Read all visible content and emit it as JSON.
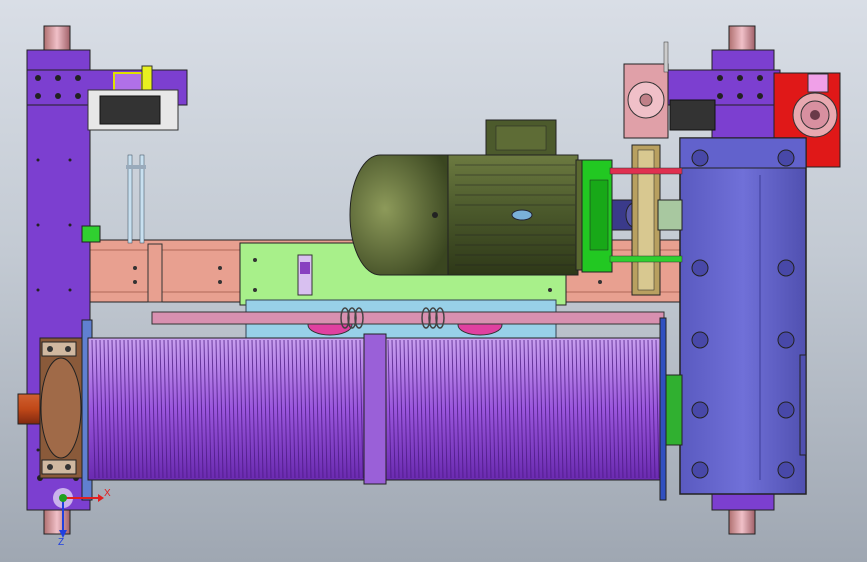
{
  "viewport": {
    "background_top": "#d9dee6",
    "background_bottom": "#9fa7b2"
  },
  "triad": {
    "x_label": "X",
    "z_label": "Z",
    "x_color": "#e02020",
    "y_color": "#20a020",
    "z_color": "#2040e0"
  },
  "colors": {
    "frame_purple": "#7c3fd0",
    "drum_purple": "#a060e0",
    "gearbox_blue": "#6a6ad0",
    "motor_green": "#4c5a2c",
    "mount_plate_green": "#a8f08a",
    "brake_red": "#e01818",
    "rail_salmon": "#e8a090",
    "bearing_brown": "#8a5a3a",
    "coupling_green": "#22c822",
    "wheel_pink": "#e0a0a8"
  },
  "parts": [
    {
      "name": "left-frame",
      "color": "frame_purple"
    },
    {
      "name": "wire-rope-drum",
      "color": "drum_purple"
    },
    {
      "name": "reducer-gearbox",
      "color": "gearbox_blue"
    },
    {
      "name": "hoist-motor",
      "color": "motor_green"
    },
    {
      "name": "motor-mount-plate",
      "color": "mount_plate_green"
    },
    {
      "name": "brake-unit",
      "color": "brake_red"
    },
    {
      "name": "cross-rail",
      "color": "rail_salmon"
    },
    {
      "name": "drum-bearing",
      "color": "bearing_brown"
    },
    {
      "name": "motor-coupling",
      "color": "coupling_green"
    },
    {
      "name": "trolley-wheels",
      "color": "wheel_pink"
    }
  ]
}
